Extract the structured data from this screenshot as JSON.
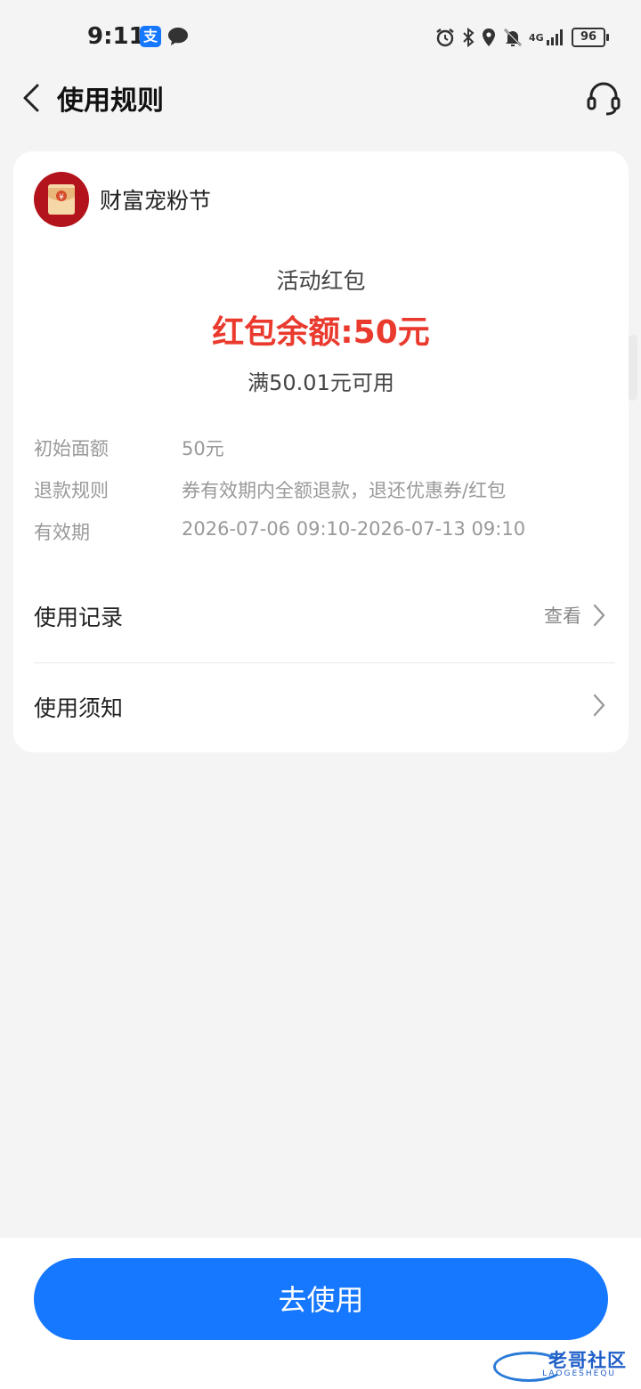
{
  "status_bar": {
    "time": "9:11",
    "alipay_glyph": "支",
    "network": "4G",
    "battery": "96"
  },
  "header": {
    "title": "使用规则"
  },
  "card": {
    "brand_name": "财富宠粉节",
    "coupon_type": "活动红包",
    "balance_text": "红包余额:50元",
    "condition_text": "满50.01元可用",
    "info": [
      {
        "label": "初始面额",
        "value": "50元"
      },
      {
        "label": "退款规则",
        "value": "券有效期内全额退款，退还优惠券/红包"
      },
      {
        "label": "有效期",
        "value": "2026-07-06 09:10-2026-07-13 09:10"
      }
    ],
    "usage_record": {
      "label": "使用记录",
      "hint": "查看"
    },
    "usage_notice": {
      "label": "使用须知"
    }
  },
  "bottom": {
    "use_button": "去使用"
  },
  "watermark": {
    "text": "老哥社区",
    "sub": "LAOGESHEQU"
  },
  "colors": {
    "accent": "#1677ff",
    "balance": "#ea3a2e",
    "brand_logo": "#b3141c"
  }
}
